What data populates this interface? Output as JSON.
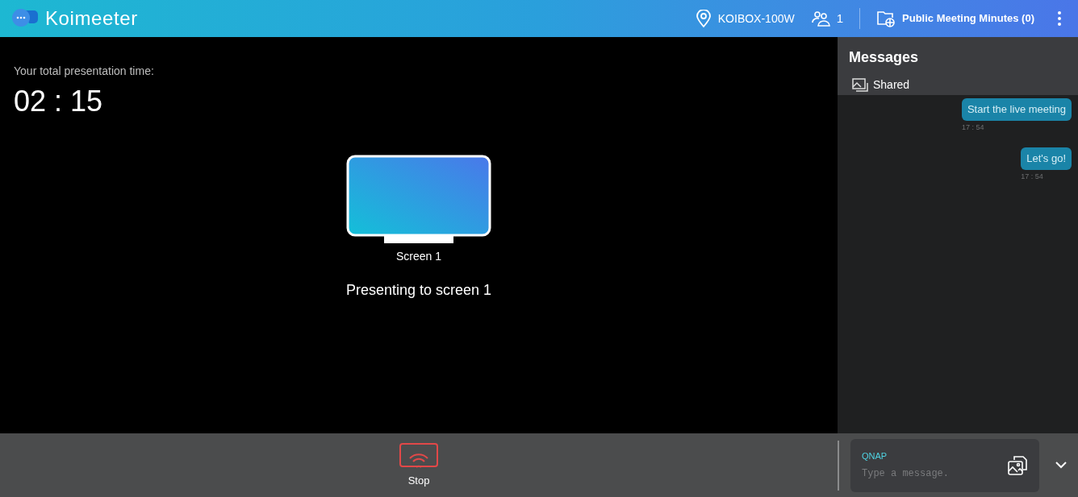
{
  "header": {
    "logo": "Koimeeter",
    "device": "KOIBOX-100W",
    "participants": "1",
    "minutes": "Public Meeting Minutes (0)"
  },
  "presentation": {
    "label": "Your total presentation time:",
    "time": "02 : 15",
    "screen_label": "Screen 1",
    "status": "Presenting to screen 1"
  },
  "messages": {
    "title": "Messages",
    "shared": "Shared",
    "items": [
      {
        "text": "Start the live meeting",
        "time": "17 : 54"
      },
      {
        "text": "Let's go!",
        "time": "17 : 54"
      }
    ]
  },
  "bottom": {
    "stop": "Stop",
    "sender": "QNAP",
    "placeholder": "Type a message."
  }
}
